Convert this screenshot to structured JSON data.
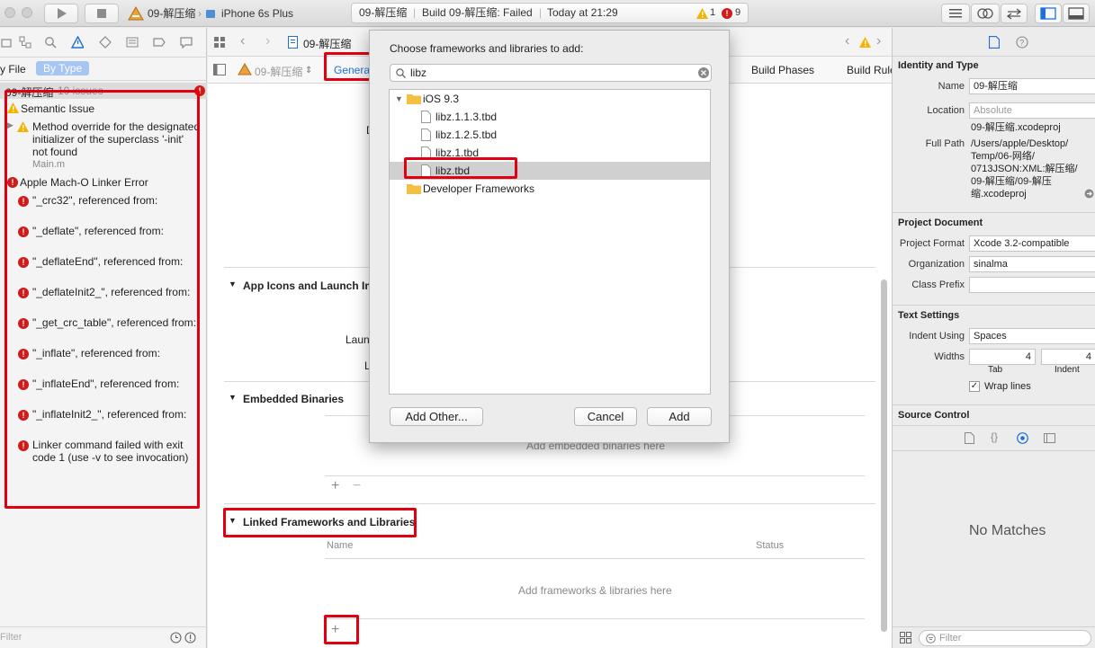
{
  "toolbar": {
    "scheme_target": "09-解压缩",
    "scheme_device": "iPhone 6s Plus",
    "activity_project": "09-解压缩",
    "activity_status": "Build 09-解压缩: Failed",
    "activity_time": "Today at 21:29",
    "warning_count": "1",
    "error_count": "9"
  },
  "navigator": {
    "filter_by_file": "y File",
    "filter_by_type": "By Type",
    "project_row": "09-解压缩",
    "issue_count": "10 issues",
    "group_semantic": "Semantic Issue",
    "semantic_issue_lines": [
      "Method override for the designated",
      "initializer of the superclass '-init'",
      "not found"
    ],
    "semantic_issue_file": "Main.m",
    "group_linker": "Apple Mach-O Linker Error",
    "linker_errors": [
      "\"_crc32\", referenced from:",
      "\"_deflate\", referenced from:",
      "\"_deflateEnd\", referenced from:",
      "\"_deflateInit2_\", referenced from:",
      "\"_get_crc_table\", referenced from:",
      "\"_inflate\", referenced from:",
      "\"_inflateEnd\", referenced from:",
      "\"_inflateInit2_\", referenced from:"
    ],
    "linker_final_lines": [
      "Linker command failed with exit",
      "code 1 (use -v to see invocation)"
    ],
    "filter_placeholder": "Filter"
  },
  "editor": {
    "breadcrumb": "09-解压缩",
    "target_selector": "09-解压缩",
    "tabs": {
      "general": "General",
      "build_phases": "Build Phases",
      "build_rules": "Build Rule"
    },
    "partial_d": "D",
    "section_app_icons": "App Icons and Launch Ima",
    "partial_launch": "Laun",
    "partial_l": "L",
    "section_embedded": "Embedded Binaries",
    "embedded_placeholder": "Add embedded binaries here",
    "section_linked": "Linked Frameworks and Libraries",
    "col_name": "Name",
    "col_status": "Status",
    "linked_placeholder": "Add frameworks & libraries here",
    "plus": "+",
    "minus": "−"
  },
  "dialog": {
    "title": "Choose frameworks and libraries to add:",
    "search_value": "libz",
    "tree": {
      "root": "iOS 9.3",
      "files": [
        "libz.1.1.3.tbd",
        "libz.1.2.5.tbd",
        "libz.1.tbd",
        "libz.tbd"
      ],
      "other_group": "Developer Frameworks"
    },
    "add_other_label": "Add Other...",
    "cancel_label": "Cancel",
    "add_label": "Add"
  },
  "inspector": {
    "identity_heading": "Identity and Type",
    "name_label": "Name",
    "name_value": "09-解压缩",
    "location_label": "Location",
    "location_value": "Absolute",
    "file_name": "09-解压缩.xcodeproj",
    "full_path_label": "Full Path",
    "full_path_lines": [
      "/Users/apple/Desktop/",
      "Temp/06-网络/",
      "0713JSON:XML:解压缩/",
      "09-解压缩/09-解压",
      "缩.xcodeproj"
    ],
    "project_doc_heading": "Project Document",
    "project_format_label": "Project Format",
    "project_format_value": "Xcode 3.2-compatible",
    "organization_label": "Organization",
    "organization_value": "sinalma",
    "class_prefix_label": "Class Prefix",
    "class_prefix_value": "",
    "text_settings_heading": "Text Settings",
    "indent_using_label": "Indent Using",
    "indent_using_value": "Spaces",
    "widths_label": "Widths",
    "tab_width": "4",
    "indent_width": "4",
    "tab_label": "Tab",
    "indent_label": "Indent",
    "wrap_lines_label": "Wrap lines",
    "wrap_check": "✓",
    "source_control_heading": "Source Control",
    "no_matches": "No Matches",
    "filter_placeholder": "Filter"
  },
  "colors": {
    "accent": "#1f6fd8",
    "error": "#d01b1b",
    "warning": "#f5b400",
    "highlight": "#e20010",
    "selected_row": "#d0d0d0"
  }
}
